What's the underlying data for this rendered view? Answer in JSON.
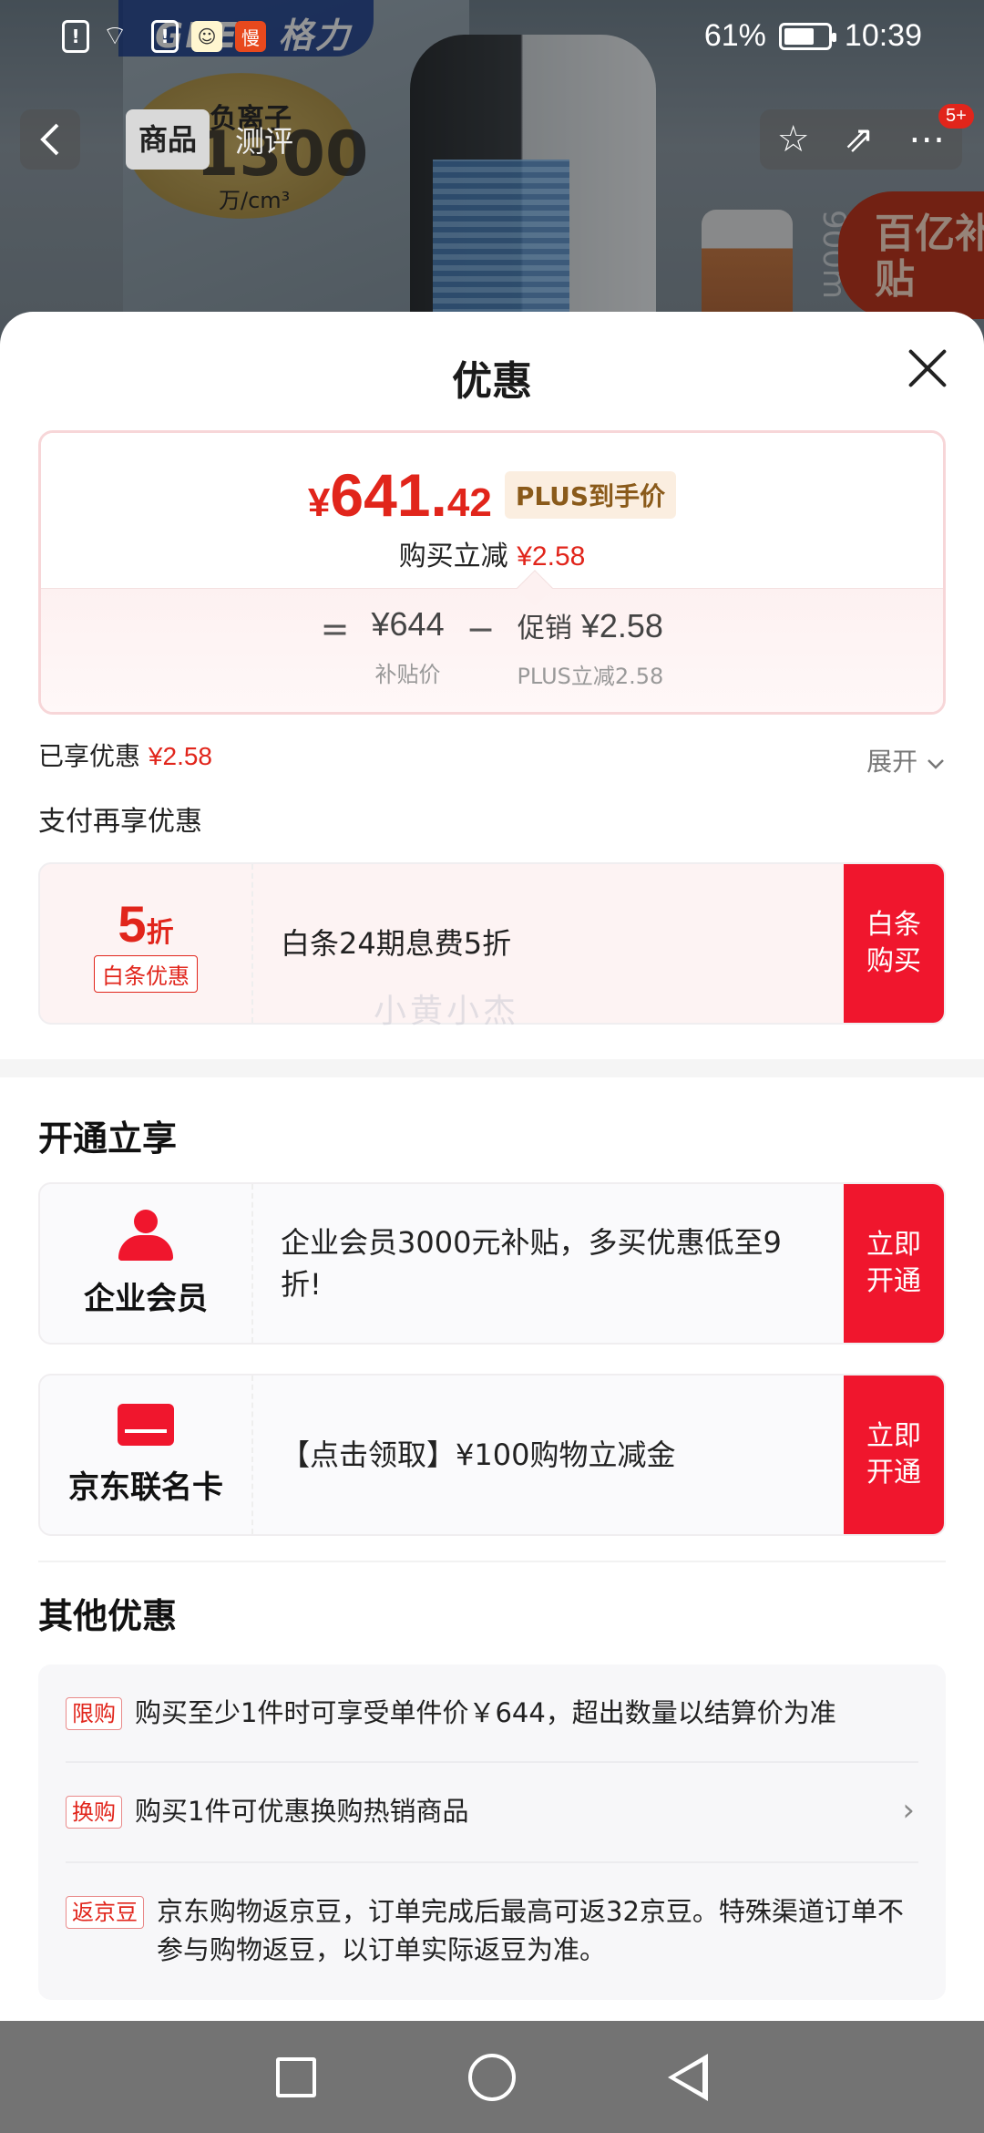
{
  "status_bar": {
    "battery": "61%",
    "battery_level": 0.61,
    "time": "10:39",
    "app_icon_label": "慢"
  },
  "background": {
    "brand_logo": "GREE 格力",
    "badge_title": "负离子",
    "badge_number": "1300",
    "badge_unit": "万/cm³",
    "subsidy": "百亿补贴",
    "vertical_text": "900m",
    "tab_goods": "商品",
    "tab_review": "测评",
    "notif_badge": "5+"
  },
  "sheet": {
    "title": "优惠",
    "price": {
      "yen": "¥",
      "int": "641.",
      "dec": "42",
      "plus_tag": "PLUS到手价"
    },
    "instant_reduce_label": "购买立减",
    "instant_reduce_value": "¥2.58",
    "formula": {
      "eq": "=",
      "base_value": "¥644",
      "base_label": "补贴价",
      "minus": "−",
      "promo_label": "促销",
      "promo_value": "¥2.58",
      "promo_sub": "PLUS立减2.58"
    },
    "enjoyed_label": "已享优惠",
    "enjoyed_value": "¥2.58",
    "expand_label": "展开",
    "pay_title": "支付再享优惠",
    "baitiao": {
      "discount_num": "5",
      "discount_unit": "折",
      "tag": "白条优惠",
      "desc": "白条24期息费5折",
      "button": "白条购买"
    },
    "watermark": "小黄小杰",
    "open_title": "开通立享",
    "enterprise": {
      "name": "企业会员",
      "desc": "企业会员3000元补贴，多买优惠低至9折!",
      "button": "立即开通"
    },
    "cobrand": {
      "name": "京东联名卡",
      "desc": "【点击领取】¥100购物立减金",
      "button": "立即开通"
    },
    "other_title": "其他优惠",
    "other_items": [
      {
        "tag": "限购",
        "text": "购买至少1件时可享受单件价￥644，超出数量以结算价为准"
      },
      {
        "tag": "换购",
        "text": "购买1件可优惠换购热销商品"
      },
      {
        "tag": "返京豆",
        "text": "京东购物返京豆，订单完成后最高可返32京豆。特殊渠道订单不参与购物返豆，以订单实际返豆为准。"
      }
    ]
  },
  "colors": {
    "accent": "#e1251b",
    "button_red": "#f0162d"
  }
}
